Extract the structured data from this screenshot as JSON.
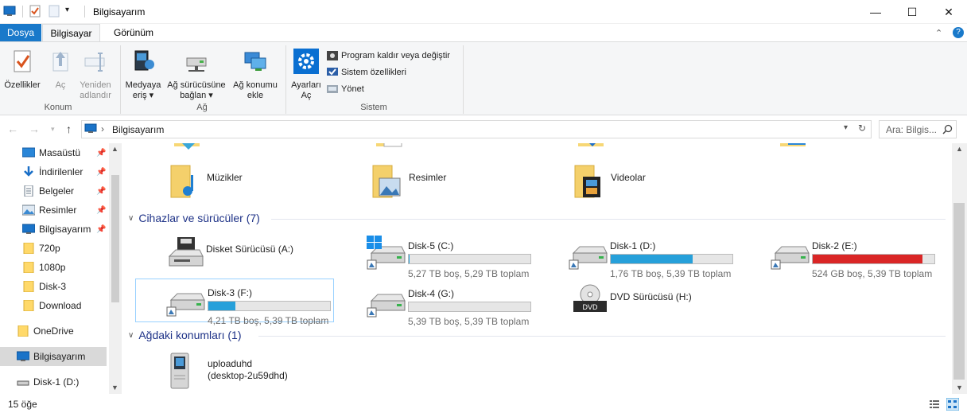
{
  "window": {
    "title": "Bilgisayarım",
    "controls": {
      "minimize": "—",
      "maximize": "☐",
      "close": "✕"
    }
  },
  "ribbon_tabs": [
    "Dosya",
    "Bilgisayar",
    "Görünüm"
  ],
  "ribbon": {
    "konum": {
      "label": "Konum",
      "buttons": [
        {
          "label": "Özellikler",
          "icon": "properties-icon"
        },
        {
          "label": "Aç",
          "icon": "open-icon"
        },
        {
          "label1": "Yeniden",
          "label2": "adlandır",
          "icon": "rename-icon"
        }
      ]
    },
    "ag": {
      "label": "Ağ",
      "buttons": [
        {
          "label1": "Medyaya",
          "label2": "eriş ▾",
          "icon": "media-icon"
        },
        {
          "label1": "Ağ sürücüsüne",
          "label2": "bağlan ▾",
          "icon": "map-drive-icon"
        },
        {
          "label1": "Ağ konumu",
          "label2": "ekle",
          "icon": "network-location-icon"
        }
      ]
    },
    "sistem": {
      "label": "Sistem",
      "open_settings": {
        "label1": "Ayarları",
        "label2": "Aç",
        "icon": "settings-gear-icon"
      },
      "small": [
        {
          "label": "Program kaldır veya değiştir",
          "icon": "uninstall-icon"
        },
        {
          "label": "Sistem özellikleri",
          "icon": "system-properties-icon"
        },
        {
          "label": "Yönet",
          "icon": "manage-icon"
        }
      ]
    }
  },
  "address": {
    "path": "Bilgisayarım",
    "search_placeholder": "Ara: Bilgis..."
  },
  "nav_pane": [
    {
      "label": "Masaüstü",
      "pinned": true,
      "icon": "desktop-icon"
    },
    {
      "label": "İndirilenler",
      "pinned": true,
      "icon": "downloads-icon"
    },
    {
      "label": "Belgeler",
      "pinned": true,
      "icon": "documents-icon"
    },
    {
      "label": "Resimler",
      "pinned": true,
      "icon": "pictures-icon"
    },
    {
      "label": "Bilgisayarım",
      "pinned": true,
      "icon": "computer-icon"
    },
    {
      "label": "720p",
      "pinned": false,
      "icon": "folder-icon"
    },
    {
      "label": "1080p",
      "pinned": false,
      "icon": "folder-icon"
    },
    {
      "label": "Disk-3",
      "pinned": false,
      "icon": "folder-icon"
    },
    {
      "label": "Download",
      "pinned": false,
      "icon": "folder-icon"
    },
    {
      "label": "OneDrive",
      "pinned": false,
      "icon": "folder-icon"
    },
    {
      "label": "Bilgisayarım",
      "pinned": false,
      "icon": "computer-icon",
      "selected": true
    },
    {
      "label": "Disk-1 (D:)",
      "pinned": false,
      "icon": "drive-icon"
    }
  ],
  "folders": [
    {
      "label": "Müzikler",
      "icon": "music-folder-icon"
    },
    {
      "label": "Resimler",
      "icon": "pictures-folder-icon"
    },
    {
      "label": "Videolar",
      "icon": "videos-folder-icon"
    }
  ],
  "devices_header": "Cihazlar ve sürücüler (7)",
  "drives": [
    {
      "name": "Disket Sürücüsü (A:)",
      "info": "",
      "used_pct": null,
      "type": "floppy"
    },
    {
      "name": "Disk-5 (C:)",
      "info": "5,27 TB boş, 5,29 TB toplam",
      "used_pct": 0.4,
      "type": "system",
      "bar_color": "#26a0da"
    },
    {
      "name": "Disk-1 (D:)",
      "info": "1,76 TB boş, 5,39 TB toplam",
      "used_pct": 67.3,
      "type": "hdd",
      "bar_color": "#26a0da"
    },
    {
      "name": "Disk-2 (E:)",
      "info": "524 GB boş, 5,39 TB toplam",
      "used_pct": 90.5,
      "type": "hdd",
      "bar_color": "#da2626"
    },
    {
      "name": "Disk-3 (F:)",
      "info": "4,21 TB boş, 5,39 TB toplam",
      "used_pct": 21.9,
      "type": "hdd",
      "bar_color": "#26a0da",
      "selected": true
    },
    {
      "name": "Disk-4 (G:)",
      "info": "5,39 TB boş, 5,39 TB toplam",
      "used_pct": 0,
      "type": "hdd",
      "bar_color": "#26a0da"
    },
    {
      "name": "DVD Sürücüsü (H:)",
      "info": "",
      "used_pct": null,
      "type": "dvd"
    }
  ],
  "network_header": "Ağdaki konumları (1)",
  "network_locations": [
    {
      "name": "uploaduhd",
      "sub": "(desktop-2u59dhd)",
      "icon": "media-server-icon"
    }
  ],
  "status": {
    "item_count": "15 öğe"
  }
}
